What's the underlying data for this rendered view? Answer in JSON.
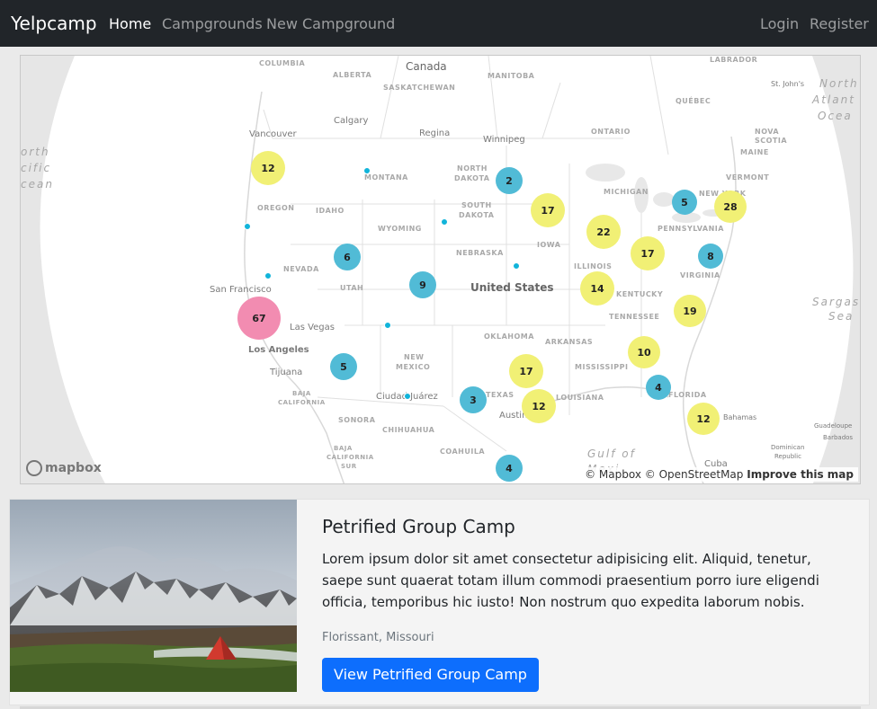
{
  "navbar": {
    "brand": "Yelpcamp",
    "links": [
      {
        "label": "Home",
        "active": true
      },
      {
        "label": "Campgrounds",
        "active": false
      },
      {
        "label": "New Campground",
        "active": false
      }
    ],
    "auth": [
      {
        "label": "Login"
      },
      {
        "label": "Register"
      }
    ]
  },
  "map": {
    "labels": {
      "canada": "Canada",
      "united_states": "United States",
      "gulf": "Gulf of",
      "gulf2": "Mexi",
      "north_atlantic_1": "North",
      "north_atlantic_2": "Atlant",
      "north_atlantic_3": "Ocea",
      "north_pacific_1": "orth",
      "north_pacific_2": "cific",
      "north_pacific_3": "cean",
      "sargasso_1": "Sargasso",
      "sargasso_2": "Sea",
      "columbia": "COLUMBIA",
      "alberta": "ALBERTA",
      "saskatchewan": "SASKATCHEWAN",
      "manitoba": "MANITOBA",
      "ontario": "ONTARIO",
      "quebec": "QUÉBEC",
      "labrador": "LABRADOR",
      "calgary": "Calgary",
      "regina": "Regina",
      "winnipeg": "Winnipeg",
      "vancouver": "Vancouver",
      "st_johns": "St. John's",
      "montana": "MONTANA",
      "north_dakota_1": "NORTH",
      "north_dakota_2": "DAKOTA",
      "south_dakota_1": "SOUTH",
      "south_dakota_2": "DAKOTA",
      "oregon": "OREGON",
      "idaho": "IDAHO",
      "wyoming": "WYOMING",
      "nebraska": "NEBRASKA",
      "iowa": "IOWA",
      "michigan": "MICHIGAN",
      "nevada": "NEVADA",
      "utah": "UTAH",
      "illinois": "ILLINOIS",
      "kentucky": "KENTUCKY",
      "virginia": "VIRGINIA",
      "pennsylvania": "PENNSYLVANIA",
      "vermont": "VERMONT",
      "new_york": "NEW YORK",
      "maine": "MAINE",
      "nova_scotia_1": "NOVA",
      "nova_scotia_2": "SCOTIA",
      "tennessee": "TENNESSEE",
      "oklahoma": "OKLAHOMA",
      "arkansas": "ARKANSAS",
      "mississippi": "MISSISSIPPI",
      "louisiana": "LOUISIANA",
      "florida": "FLORIDA",
      "texas": "TEXAS",
      "new_mexico_1": "NEW",
      "new_mexico_2": "MEXICO",
      "baja_california_1": "BAJA",
      "baja_california_2": "CALIFORNIA",
      "baja_california_sur_1": "BAJA",
      "baja_california_sur_2": "CALIFORNIA",
      "baja_california_sur_3": "SUR",
      "sonora": "SONORA",
      "chihuahua": "CHIHUAHUA",
      "coahuila": "COAHUILA",
      "san_francisco": "San Francisco",
      "las_vegas": "Las Vegas",
      "los_angeles": "Los Angeles",
      "tijuana": "Tijuana",
      "ciudad_juarez": "Ciudad Juárez",
      "austin": "Austin",
      "bahamas": "Bahamas",
      "cuba": "Cuba",
      "guadeloupe": "Guadeloupe",
      "barbados": "Barbados",
      "dominican_1": "Dominican",
      "dominican_2": "Republic"
    },
    "clusters": [
      {
        "count": "12",
        "color": "#f1f075"
      },
      {
        "count": "2",
        "color": "#51bbd6"
      },
      {
        "count": "17",
        "color": "#f1f075"
      },
      {
        "count": "22",
        "color": "#f1f075"
      },
      {
        "count": "5",
        "color": "#51bbd6"
      },
      {
        "count": "28",
        "color": "#f1f075"
      },
      {
        "count": "6",
        "color": "#51bbd6"
      },
      {
        "count": "17",
        "color": "#f1f075"
      },
      {
        "count": "8",
        "color": "#51bbd6"
      },
      {
        "count": "9",
        "color": "#51bbd6"
      },
      {
        "count": "14",
        "color": "#f1f075"
      },
      {
        "count": "19",
        "color": "#f1f075"
      },
      {
        "count": "67",
        "color": "#f28cb1"
      },
      {
        "count": "10",
        "color": "#f1f075"
      },
      {
        "count": "5",
        "color": "#51bbd6"
      },
      {
        "count": "17",
        "color": "#f1f075"
      },
      {
        "count": "4",
        "color": "#51bbd6"
      },
      {
        "count": "3",
        "color": "#51bbd6"
      },
      {
        "count": "12",
        "color": "#f1f075"
      },
      {
        "count": "12",
        "color": "#f1f075"
      },
      {
        "count": "4",
        "color": "#51bbd6"
      }
    ],
    "point_color": "#11b4da",
    "logo": "mapbox",
    "attribution": "© Mapbox © OpenStreetMap",
    "improve": "Improve this map"
  },
  "campground": {
    "title": "Petrified Group Camp",
    "description": "Lorem ipsum dolor sit amet consectetur adipisicing elit. Aliquid, tenetur, saepe sunt quaerat totam illum commodi praesentium porro iure eligendi officia, temporibus hic iusto! Non nostrum quo expedita laborum nobis.",
    "location": "Florissant, Missouri",
    "button": "View Petrified Group Camp"
  }
}
